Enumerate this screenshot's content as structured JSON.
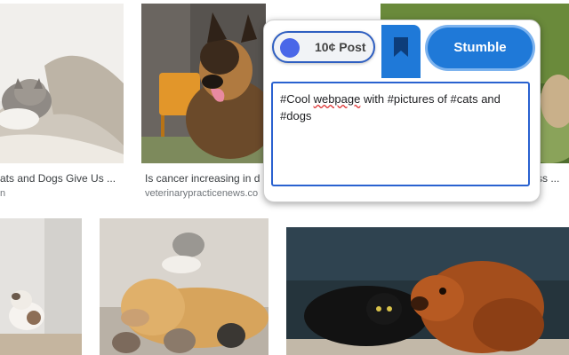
{
  "results": {
    "card1": {
      "caption": "ats and Dogs Give Us ...",
      "source": "n"
    },
    "card2": {
      "caption": "Is cancer increasing in d",
      "source": "veterinarypracticenews.co"
    },
    "card3": {
      "caption": "ss ..."
    }
  },
  "popup": {
    "post_label": "10¢ Post",
    "bookmark_icon": "bookmark-icon",
    "stumble_label": "Stumble",
    "editor": {
      "parts": [
        "#Cool ",
        "webpage",
        " with #pictures of #cats and",
        "#dogs"
      ]
    }
  },
  "colors": {
    "accent": "#1f79d8",
    "accent_ring": "#7db3ee",
    "toggle_dot": "#4a67e8",
    "editor_border": "#2a62d0"
  }
}
